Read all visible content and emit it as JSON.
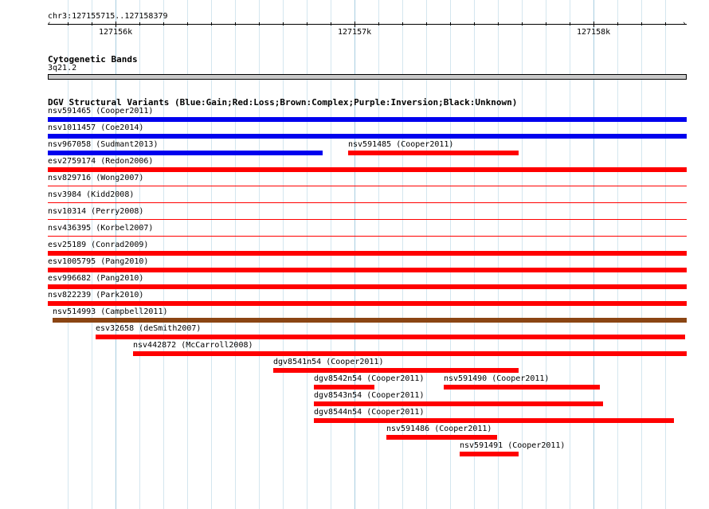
{
  "ruler": {
    "location": "chr3:127155715..127158379",
    "ticks": [
      "127156k",
      "127157k",
      "127158k"
    ]
  },
  "cyto": {
    "title": "Cytogenetic Bands",
    "band_label": "3q21.2"
  },
  "dgv": {
    "title": "DGV Structural Variants (Blue:Gain;Red:Loss;Brown:Complex;Purple:Inversion;Black:Unknown)",
    "colors": {
      "gain": "#0000ee",
      "loss": "#ff0000",
      "complex": "#8b4513"
    },
    "features": [
      {
        "label": "nsv591465 (Cooper2011)",
        "type": "gain"
      },
      {
        "label": "nsv1011457 (Coe2014)",
        "type": "gain"
      },
      {
        "label": "nsv967058 (Sudmant2013)",
        "type": "gain"
      },
      {
        "label": "nsv591485 (Cooper2011)",
        "type": "loss"
      },
      {
        "label": "esv2759174 (Redon2006)",
        "type": "loss"
      },
      {
        "label": "nsv829716 (Wong2007)",
        "type": "loss"
      },
      {
        "label": "nsv3984 (Kidd2008)",
        "type": "loss"
      },
      {
        "label": "nsv10314 (Perry2008)",
        "type": "loss"
      },
      {
        "label": "nsv436395 (Korbel2007)",
        "type": "loss"
      },
      {
        "label": "esv25189 (Conrad2009)",
        "type": "loss"
      },
      {
        "label": "esv1005795 (Pang2010)",
        "type": "loss"
      },
      {
        "label": "esv996682 (Pang2010)",
        "type": "loss"
      },
      {
        "label": "nsv822239 (Park2010)",
        "type": "loss"
      },
      {
        "label": "nsv514993 (Campbell2011)",
        "type": "complex"
      },
      {
        "label": "esv32658 (deSmith2007)",
        "type": "loss"
      },
      {
        "label": "nsv442872 (McCarroll2008)",
        "type": "loss"
      },
      {
        "label": "dgv8541n54 (Cooper2011)",
        "type": "loss"
      },
      {
        "label": "dgv8542n54 (Cooper2011)",
        "type": "loss"
      },
      {
        "label": "nsv591490 (Cooper2011)",
        "type": "loss"
      },
      {
        "label": "dgv8543n54 (Cooper2011)",
        "type": "loss"
      },
      {
        "label": "dgv8544n54 (Cooper2011)",
        "type": "loss"
      },
      {
        "label": "nsv591486 (Cooper2011)",
        "type": "loss"
      },
      {
        "label": "nsv591491 (Cooper2011)",
        "type": "loss"
      }
    ]
  }
}
